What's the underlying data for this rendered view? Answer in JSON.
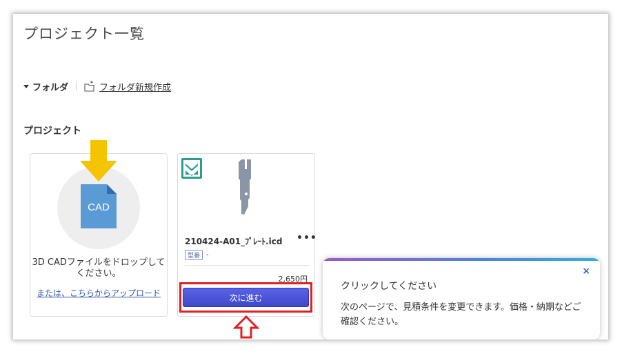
{
  "page": {
    "title": "プロジェクト一覧"
  },
  "folders": {
    "toggle_label": "フォルダ",
    "new_folder_label": "フォルダ新規作成"
  },
  "projects_section": {
    "title": "プロジェクト"
  },
  "drop_card": {
    "file_label": "CAD",
    "instruction": "3D CADファイルをドロップしてください。",
    "upload_link": "または、こちらからアップロード"
  },
  "project_card": {
    "name": "210424-A01_ﾌﾟﾚｰﾄ.icd",
    "more_label": "•••",
    "type_tag": "型番",
    "type_value": "-",
    "price": "2,650円",
    "next_button": "次に進む"
  },
  "popover": {
    "close_label": "×",
    "title": "クリックしてください",
    "body": "次のページで、見積条件を変更できます。価格・納期などご確認ください。"
  },
  "colors": {
    "accent_button": "#4a53d9",
    "highlight_red": "#e02020",
    "arrow_yellow": "#f5c400",
    "badge_teal": "#2a9d8f",
    "cad_blue": "#5b9bd5"
  }
}
